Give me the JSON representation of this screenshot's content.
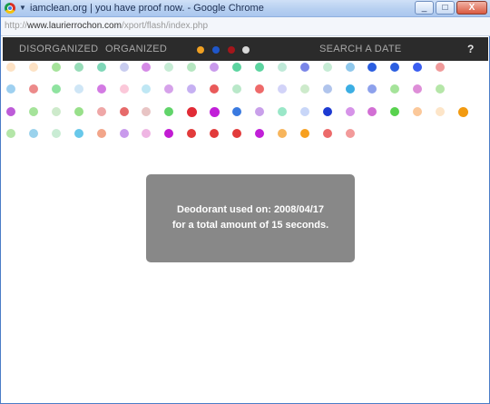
{
  "window": {
    "title": "iamclean.org | you have proof now. - Google Chrome",
    "controls": [
      "_",
      "□",
      "X"
    ]
  },
  "address_bar": {
    "url_prefix": "http://",
    "url_host": "www.laurierrochon.com",
    "url_path": "/xport/flash/index.php"
  },
  "nav": {
    "disorganized": "DISORGANIZED",
    "organized": "ORGANIZED",
    "search": "SEARCH A DATE",
    "help": "?",
    "swatches": [
      "#f0a022",
      "#1f56c9",
      "#a3161b",
      "#d8d8d8"
    ]
  },
  "dot_rows": [
    [
      "#fde2c4",
      "#fde2c4",
      "#a5e39a",
      "#97dcb8",
      "#7fd7b8",
      "#c8ccef",
      "#d58ae6",
      "#c6ecd5",
      "#b5e6c0",
      "#c99aec",
      "#5cd4a0",
      "#5cd4a0",
      "#bfe9d8",
      "#7a86e8",
      "#c6ecd5",
      "#8fc8ec",
      "#2b5ee0",
      "#2b5ee0",
      "#3b5ef0",
      "#f09a9a"
    ],
    [
      "#9ed0f0",
      "#ec8a8a",
      "#8fe3a0",
      "#cfe6f6",
      "#d37ae3",
      "#fbc8d9",
      "#bfe7f4",
      "#d6a2ea",
      "#c6b0f2",
      "#e95a5a",
      "#b9e8c9",
      "#ee6a6a",
      "#d2d3f8",
      "#cdeacb",
      "#b0c4ec",
      "#3caee3",
      "#8da1ec",
      "#a5e39a",
      "#de8ed8",
      "#b5e6a8"
    ],
    [
      "#bd5cd8",
      "#a5e39a",
      "#cdeacb",
      "#98e08a",
      "#efa7a7",
      "#e66a6a",
      "#e8c4c4",
      "#61d46a",
      "#e12b36",
      "#c11fd8",
      "#3a7ae0",
      "#c9a0ea",
      "#9ae7c8",
      "#c8d6f8",
      "#1d3ad2",
      "#d693e8",
      "#d26fd4",
      "#58d24e",
      "#fbc89a",
      "#fde5c8",
      "#f29a10"
    ],
    [
      "#b4e6a8",
      "#9ad2ec",
      "#c9ecd4",
      "#68c8ea",
      "#f2a58a",
      "#c99aec",
      "#efb5e3",
      "#c21bd3",
      "#e23b3b",
      "#e23b3b",
      "#e23b3b",
      "#c11fd8",
      "#f7b55c",
      "#f7a01f",
      "#ec6a6a",
      "#f29a9a"
    ]
  ],
  "info": {
    "line1": "Deodorant used on: 2008/04/17",
    "line2": "for a total amount of 15 seconds."
  }
}
